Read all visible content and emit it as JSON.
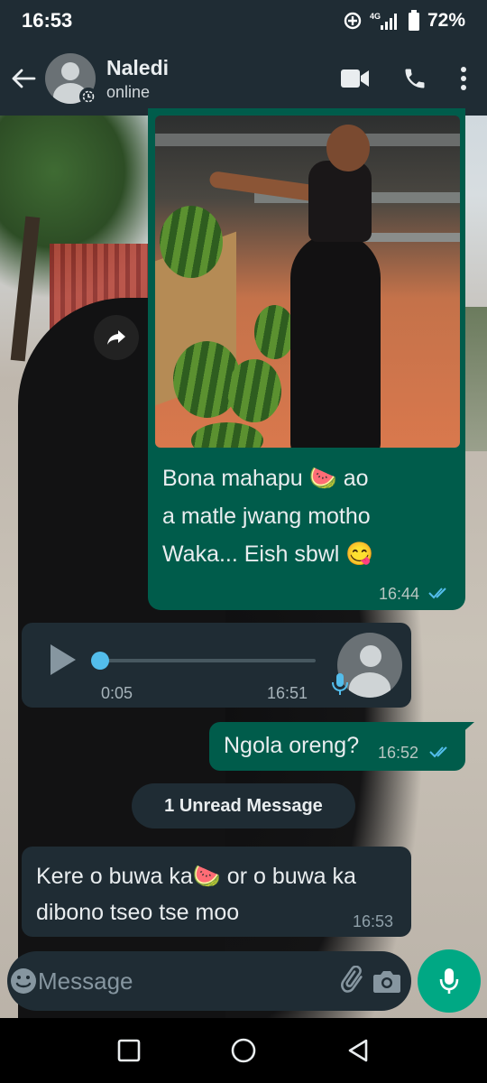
{
  "status_bar": {
    "time": "16:53",
    "network": "4G",
    "battery": "72%",
    "icons": [
      "data-saver-icon",
      "signal-icon",
      "battery-icon"
    ]
  },
  "header": {
    "contact_name": "Naledi",
    "contact_status": "online",
    "icons": [
      "back-arrow-icon",
      "video-call-icon",
      "voice-call-icon",
      "more-vertical-icon"
    ]
  },
  "messages": [
    {
      "type": "image",
      "direction": "outgoing",
      "lines": [
        "Bona mahapu 🍉 ao",
        "a matle jwang motho",
        "Waka... Eish sbwl 😋"
      ],
      "time": "16:44",
      "status": "read"
    },
    {
      "type": "voice",
      "direction": "incoming",
      "duration": "0:05",
      "time": "16:51",
      "progress": 0
    },
    {
      "type": "text",
      "direction": "outgoing",
      "text": "Ngola oreng?",
      "time": "16:52",
      "status": "read"
    },
    {
      "type": "text",
      "direction": "incoming",
      "lines": [
        "Kere o buwa ka🍉 or o buwa ka",
        "dibono tseo tse moo"
      ],
      "time": "16:53"
    }
  ],
  "unread_divider": "1 Unread Message",
  "input": {
    "placeholder": "Message",
    "value": ""
  },
  "colors": {
    "header_bg": "#1f2c34",
    "outgoing_bubble": "#005c4b",
    "incoming_bubble": "#1f2c34",
    "accent": "#00a884",
    "read_ticks": "#53bdeb"
  }
}
